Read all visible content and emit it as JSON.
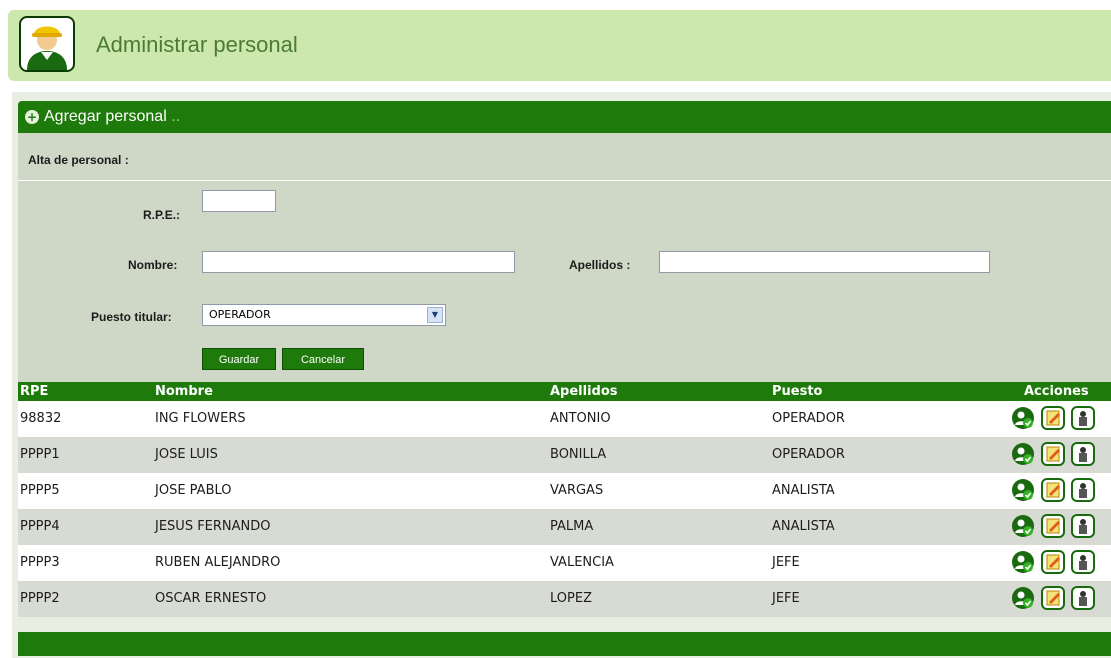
{
  "header": {
    "title": "Administrar personal",
    "avatar_icon": "worker-avatar-icon"
  },
  "panel": {
    "bar_label": "Agregar personal",
    "bar_dots": "..",
    "subtitle": "Alta de personal :"
  },
  "form": {
    "rpe_label": "R.P.E.:",
    "rpe_value": "",
    "nombre_label": "Nombre:",
    "nombre_value": "",
    "apellidos_label": "Apellidos :",
    "apellidos_value": "",
    "puesto_label": "Puesto titular:",
    "puesto_value": "OPERADOR",
    "save_label": "Guardar",
    "cancel_label": "Cancelar"
  },
  "table": {
    "columns": [
      "RPE",
      "Nombre",
      "Apellidos",
      "Puesto",
      "Acciones"
    ],
    "rows": [
      {
        "rpe": "98832",
        "nombre": "ING FLOWERS",
        "apellidos": "ANTONIO",
        "puesto": "OPERADOR"
      },
      {
        "rpe": "PPPP1",
        "nombre": "JOSE LUIS",
        "apellidos": "BONILLA",
        "puesto": "OPERADOR"
      },
      {
        "rpe": "PPPP5",
        "nombre": "JOSE PABLO",
        "apellidos": "VARGAS",
        "puesto": "ANALISTA"
      },
      {
        "rpe": "PPPP4",
        "nombre": "JESUS FERNANDO",
        "apellidos": "PALMA",
        "puesto": "ANALISTA"
      },
      {
        "rpe": "PPPP3",
        "nombre": "RUBEN ALEJANDRO",
        "apellidos": "VALENCIA",
        "puesto": "JEFE"
      },
      {
        "rpe": "PPPP2",
        "nombre": "OSCAR ERNESTO",
        "apellidos": "LOPEZ",
        "puesto": "JEFE"
      }
    ],
    "action_icons": [
      "assign-user-icon",
      "edit-icon",
      "delete-user-icon"
    ]
  },
  "colors": {
    "brand_green": "#1f7a0c",
    "header_bg": "#cde8ad",
    "form_bg": "#cfd7c6"
  }
}
